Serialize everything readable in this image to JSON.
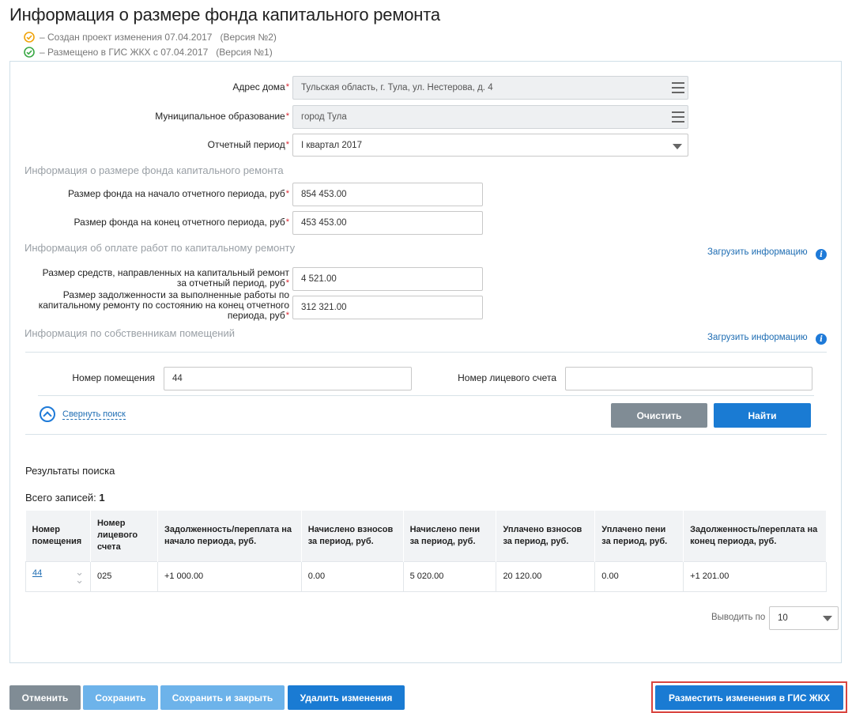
{
  "page_title": "Информация о размере фонда капитального ремонта",
  "statuses": [
    {
      "icon": "pending-check-icon",
      "color": "#f0a30a",
      "text": "–  Создан проект изменения 07.04.2017",
      "version": "(Версия №2)"
    },
    {
      "icon": "published-check-icon",
      "color": "#3aa845",
      "text": "–  Размещено в ГИС ЖКХ с 07.04.2017",
      "version": "(Версия №1)"
    }
  ],
  "form": {
    "address_label": "Адрес дома",
    "address_value": "Тульская область, г. Тула, ул. Нестерова, д. 4",
    "municipality_label": "Муниципальное образование",
    "municipality_value": "город Тула",
    "period_label": "Отчетный период",
    "period_value": "I квартал 2017",
    "required_mark": "*"
  },
  "fund_section": {
    "title": "Информация о размере фонда капитального ремонта",
    "start_label": "Размер фонда на начало отчетного периода, руб",
    "start_value": "854 453.00",
    "end_label": "Размер фонда на конец отчетного периода, руб",
    "end_value": "453 453.00"
  },
  "payment_section": {
    "title": "Информация об оплате работ по капитальному ремонту",
    "upload_link": "Загрузить информацию",
    "spent_label": "Размер средств, направленных на капитальный ремонт за отчетный период, руб",
    "spent_value": "4 521.00",
    "debt_label": "Размер задолженности за выполненные работы по капитальному ремонту по состоянию на конец отчетного периода, руб",
    "debt_value": "312 321.00"
  },
  "owners_section": {
    "title": "Информация по собственникам помещений",
    "upload_link": "Загрузить информацию"
  },
  "search": {
    "room_label": "Номер помещения",
    "room_value": "44",
    "account_label": "Номер лицевого счета",
    "account_value": "",
    "collapse_label": "Свернуть поиск",
    "clear_label": "Очистить",
    "find_label": "Найти"
  },
  "results": {
    "title": "Результаты поиска",
    "total_label": "Всего записей:",
    "total_value": "1",
    "columns": [
      "Номер помещения",
      "Номер лицевого счета",
      "Задолженность/переплата на начало периода, руб.",
      "Начислено взносов за период, руб.",
      "Начислено пени за период, руб.",
      "Уплачено взносов за период, руб.",
      "Уплачено пени за период, руб.",
      "Задолженность/переплата на конец периода, руб."
    ],
    "rows": [
      {
        "room": "44",
        "account": "025",
        "debt_start": "+1 000.00",
        "accrued": "0.00",
        "penalty": "5 020.00",
        "paid": "20 120.00",
        "paid_penalty": "0.00",
        "debt_end": "+1 201.00"
      }
    ],
    "page_size_label": "Выводить по",
    "page_size_value": "10"
  },
  "footer": {
    "cancel": "Отменить",
    "save": "Сохранить",
    "save_close": "Сохранить и закрыть",
    "delete_changes": "Удалить изменения",
    "publish": "Разместить изменения в ГИС ЖКХ"
  },
  "colors": {
    "accent": "#1a7bd3",
    "positive": "#3a8a1e",
    "required": "#d9232e"
  }
}
